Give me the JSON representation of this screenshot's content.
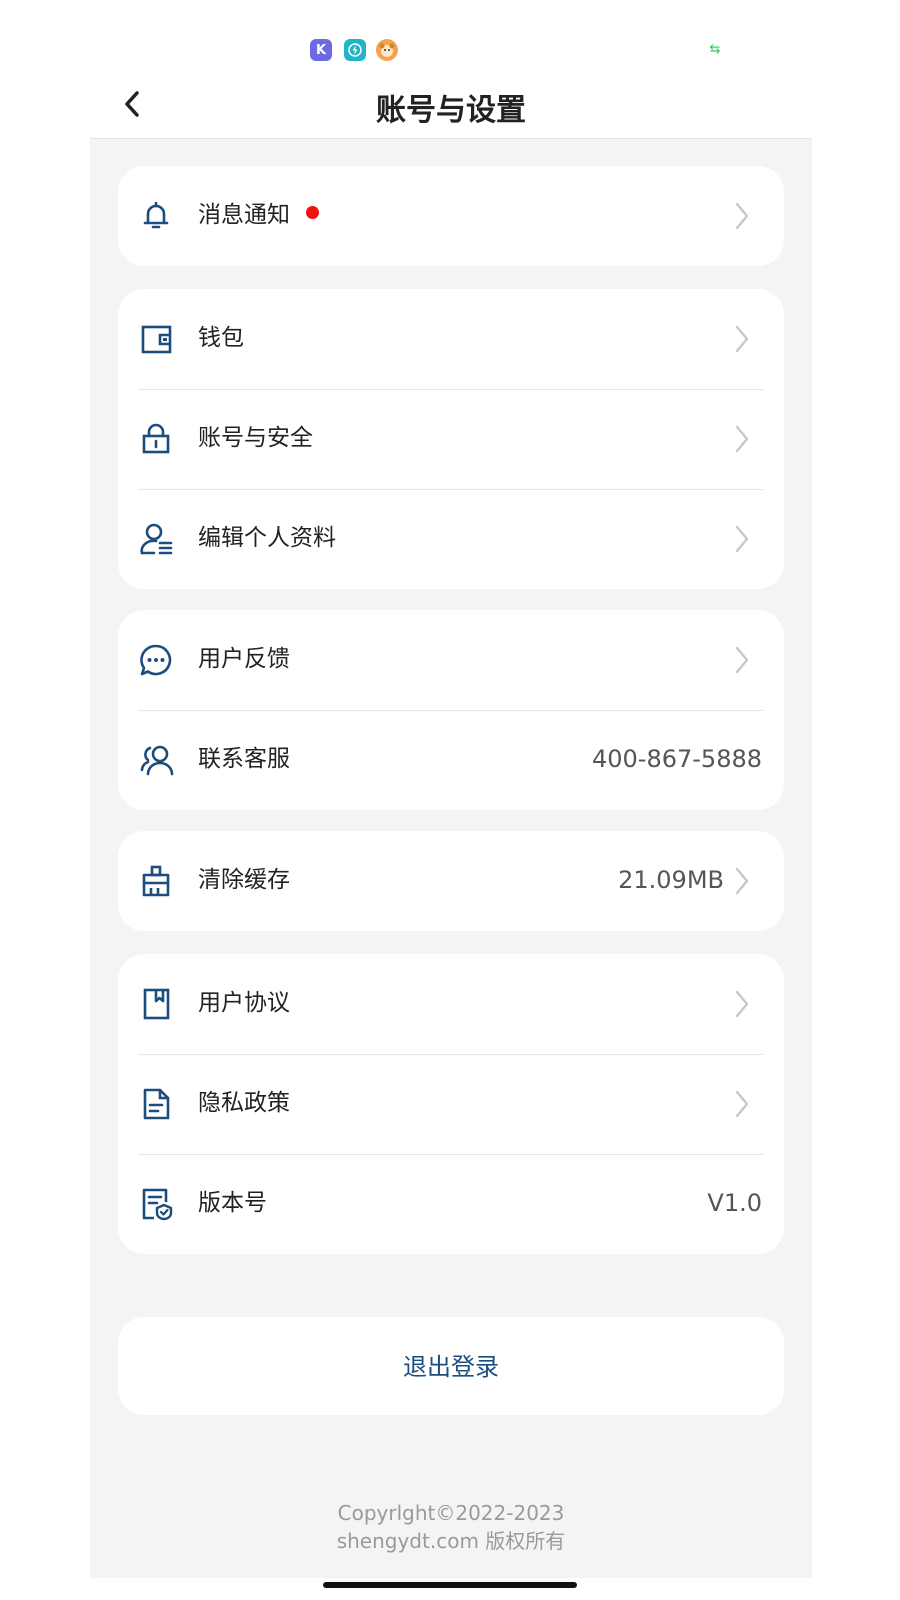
{
  "header": {
    "title": "账号与设置"
  },
  "groups": [
    {
      "rows": [
        {
          "label": "消息通知",
          "icon": "bell-icon",
          "has_badge": true
        }
      ]
    },
    {
      "rows": [
        {
          "label": "钱包",
          "icon": "wallet-icon"
        },
        {
          "label": "账号与安全",
          "icon": "lock-icon"
        },
        {
          "label": "编辑个人资料",
          "icon": "edit-profile-icon"
        }
      ]
    },
    {
      "rows": [
        {
          "label": "用户反馈",
          "icon": "chat-bubble-icon"
        },
        {
          "label": "联系客服",
          "icon": "customer-service-icon",
          "value": "400-867-5888"
        }
      ]
    },
    {
      "rows": [
        {
          "label": "清除缓存",
          "icon": "broom-icon",
          "value": "21.09MB"
        }
      ]
    },
    {
      "rows": [
        {
          "label": "用户协议",
          "icon": "bookmark-document-icon"
        },
        {
          "label": "隐私政策",
          "icon": "document-icon"
        },
        {
          "label": "版本号",
          "icon": "version-shield-icon",
          "value": "V1.0"
        }
      ]
    }
  ],
  "logout": {
    "label": "退出登录"
  },
  "footer": {
    "line1": "Copyrlght©2022-2023",
    "line2": "shengydt.com 版权所有"
  },
  "colors": {
    "accent": "#1d4d7c",
    "badge": "#ee1111",
    "page_bg": "#f4f4f4",
    "card_bg": "#ffffff"
  }
}
